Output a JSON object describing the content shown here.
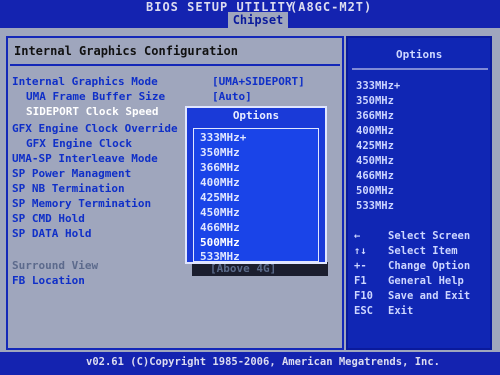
{
  "header": {
    "title": "BIOS SETUP UTILITY",
    "board": "(A8GC-M2T)",
    "active_tab": "Chipset"
  },
  "section": {
    "title": "Internal Graphics Configuration"
  },
  "settings": [
    {
      "label": "Internal Graphics Mode",
      "value": "[UMA+SIDEPORT]"
    },
    {
      "label": "UMA Frame Buffer Size",
      "value": "[Auto]"
    },
    {
      "label": "SIDEPORT Clock Speed",
      "value": ""
    },
    {
      "label": "GFX Engine Clock Override",
      "value": ""
    },
    {
      "label": "GFX Engine Clock",
      "value": ""
    },
    {
      "label": "UMA-SP Interleave Mode",
      "value": ""
    },
    {
      "label": "SP Power Managment",
      "value": ""
    },
    {
      "label": "SP NB Termination",
      "value": ""
    },
    {
      "label": "SP Memory Termination",
      "value": ""
    },
    {
      "label": "SP CMD Hold",
      "value": ""
    },
    {
      "label": "SP DATA Hold",
      "value": ""
    },
    {
      "label": "Surround View",
      "value": ""
    },
    {
      "label": "FB Location",
      "value": "[Above 4G]"
    }
  ],
  "popup": {
    "title": "Options",
    "items": [
      "333MHz+",
      "350MHz",
      "366MHz",
      "400MHz",
      "425MHz",
      "450MHz",
      "466MHz",
      "500MHz",
      "533MHz"
    ],
    "selected": "500MHz"
  },
  "sidebar": {
    "title": "Options",
    "options": [
      "333MHz+",
      "350MHz",
      "366MHz",
      "400MHz",
      "425MHz",
      "450MHz",
      "466MHz",
      "500MHz",
      "533MHz"
    ],
    "help": [
      {
        "key": "←",
        "action": "Select Screen"
      },
      {
        "key": "↑↓",
        "action": "Select Item"
      },
      {
        "key": "+-",
        "action": "Change Option"
      },
      {
        "key": "F1",
        "action": "General Help"
      },
      {
        "key": "F10",
        "action": "Save and Exit"
      },
      {
        "key": "ESC",
        "action": "Exit"
      }
    ]
  },
  "footer": {
    "text": "v02.61 (C)Copyright 1985-2006, American Megatrends, Inc."
  }
}
